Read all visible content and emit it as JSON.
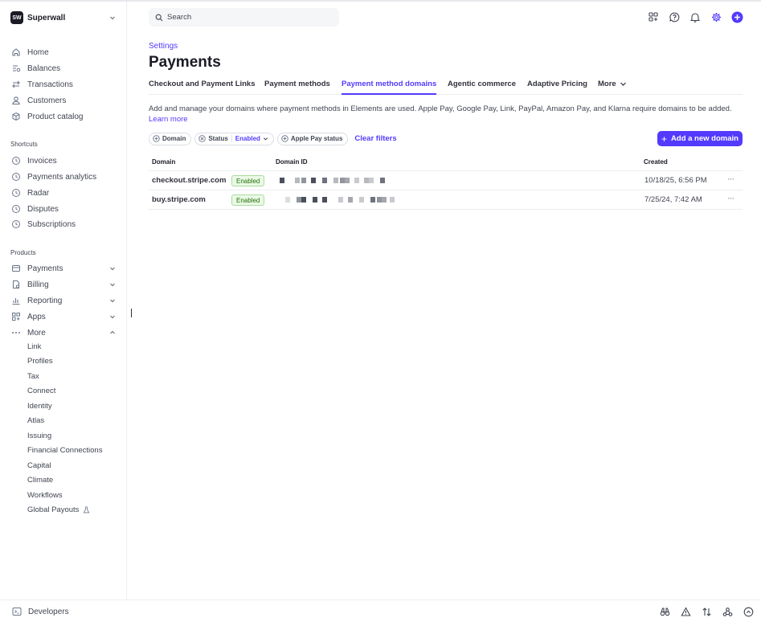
{
  "account": {
    "logo": "SW",
    "name": "Superwall"
  },
  "search": {
    "placeholder": "Search"
  },
  "nav": {
    "main": [
      {
        "label": "Home",
        "icon": "home-icon"
      },
      {
        "label": "Balances",
        "icon": "balances-icon"
      },
      {
        "label": "Transactions",
        "icon": "transactions-icon"
      },
      {
        "label": "Customers",
        "icon": "customers-icon"
      },
      {
        "label": "Product catalog",
        "icon": "product-catalog-icon"
      }
    ],
    "shortcuts_title": "Shortcuts",
    "shortcuts": [
      {
        "label": "Invoices",
        "icon": "clock-icon"
      },
      {
        "label": "Payments analytics",
        "icon": "clock-icon"
      },
      {
        "label": "Radar",
        "icon": "clock-icon"
      },
      {
        "label": "Disputes",
        "icon": "clock-icon"
      },
      {
        "label": "Subscriptions",
        "icon": "clock-icon"
      }
    ],
    "products_title": "Products",
    "products": [
      {
        "label": "Payments",
        "icon": "payments-icon"
      },
      {
        "label": "Billing",
        "icon": "billing-icon"
      },
      {
        "label": "Reporting",
        "icon": "reporting-icon"
      },
      {
        "label": "Apps",
        "icon": "apps-icon"
      },
      {
        "label": "More",
        "icon": "more-icon"
      }
    ],
    "more_items": [
      "Link",
      "Profiles",
      "Tax",
      "Connect",
      "Identity",
      "Atlas",
      "Issuing",
      "Financial Connections",
      "Capital",
      "Climate",
      "Workflows",
      "Global Payouts"
    ],
    "developers": "Developers"
  },
  "header": {
    "breadcrumb": "Settings",
    "title": "Payments",
    "tabs": [
      {
        "label": "Checkout and Payment Links"
      },
      {
        "label": "Payment methods"
      },
      {
        "label": "Payment method domains",
        "active": true
      },
      {
        "label": "Agentic commerce"
      },
      {
        "label": "Adaptive Pricing"
      },
      {
        "label": "More"
      }
    ]
  },
  "content": {
    "description": "Add and manage your domains where payment methods in Elements are used. Apple Pay, Google Pay, Link, PayPal, Amazon Pay, and Klarna require domains to be added.",
    "learn_more": "Learn more",
    "filters": {
      "domain": "Domain",
      "status": "Status",
      "status_value": "Enabled",
      "apple_pay": "Apple Pay status",
      "clear": "Clear filters"
    },
    "add_button": "Add a new domain",
    "table": {
      "headers": {
        "domain": "Domain",
        "domain_id": "Domain ID",
        "created": "Created"
      },
      "rows": [
        {
          "domain": "checkout.stripe.com",
          "status": "Enabled",
          "created": "10/18/25, 6:56 PM",
          "more": "···"
        },
        {
          "domain": "buy.stripe.com",
          "status": "Enabled",
          "created": "7/25/24, 7:42 AM",
          "more": "···"
        }
      ]
    }
  },
  "colors": {
    "accent": "#533afd",
    "badge_green": "#217005"
  }
}
